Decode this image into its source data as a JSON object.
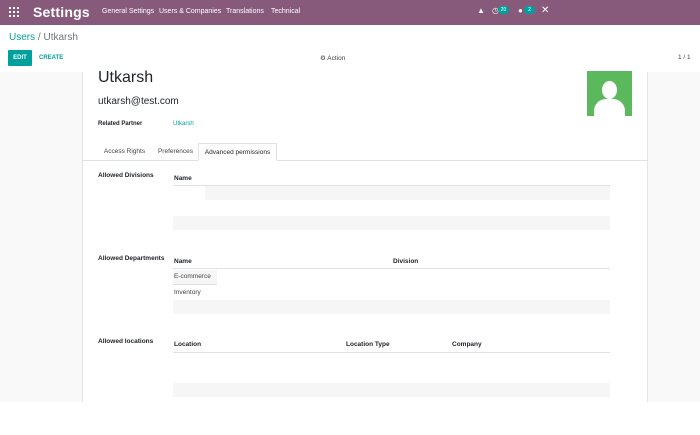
{
  "navbar": {
    "brand": "Settings",
    "menu": [
      "General Settings",
      "Users & Companies",
      "Translations",
      "Technical"
    ],
    "activity_count": "20",
    "message_count": "2",
    "colors": {
      "bar": "#875a7b",
      "badge": "#00a09d"
    },
    "icons": [
      "apps-grid-icon",
      "bug-icon",
      "activity-clock-icon",
      "chat-icon",
      "close-icon"
    ]
  },
  "breadcrumb": {
    "parent": "Users",
    "separator": "/",
    "current": "Utkarsh"
  },
  "control": {
    "edit": "EDIT",
    "create": "CREATE",
    "action": "Action",
    "pager": "1 / 1"
  },
  "record": {
    "name": "Utkarsh",
    "email": "utkarsh@test.com",
    "related_partner_label": "Related Partner",
    "related_partner_value": "Utkarsh"
  },
  "tabs": [
    "Access Rights",
    "Preferences",
    "Advanced permissions"
  ],
  "active_tab": "Advanced permissions",
  "divisions": {
    "label": "Allowed Divisions",
    "columns": [
      "Name"
    ],
    "rows": []
  },
  "departments": {
    "label": "Allowed Departments",
    "columns": [
      "Name",
      "Division"
    ],
    "rows": [
      [
        "E-commerce",
        ""
      ],
      [
        "Inventory",
        ""
      ]
    ]
  },
  "locations": {
    "label": "Allowed locations",
    "columns": [
      "Location",
      "Location Type",
      "Company"
    ],
    "rows": []
  }
}
